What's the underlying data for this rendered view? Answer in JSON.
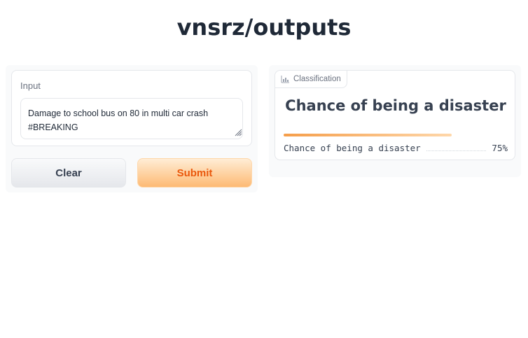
{
  "page": {
    "title": "vnsrz/outputs"
  },
  "input": {
    "label": "Input",
    "value": "Damage to school bus on 80 in multi car crash #BREAKING"
  },
  "buttons": {
    "clear": "Clear",
    "submit": "Submit"
  },
  "output": {
    "tag_label": "Classification",
    "heading": "Chance of being a disaster",
    "confidences": [
      {
        "label": "Chance of being a disaster",
        "value_text": "75%",
        "value": 0.75
      }
    ]
  },
  "colors": {
    "accent": "#ea580c",
    "submit_gradient_top": "#ffedd5",
    "submit_gradient_bottom": "#fdba74",
    "bar_start": "#f59e4a",
    "bar_end": "#fed7aa"
  },
  "icons": {
    "classification": "bar-chart-icon",
    "resize": "resize-grip-icon"
  }
}
